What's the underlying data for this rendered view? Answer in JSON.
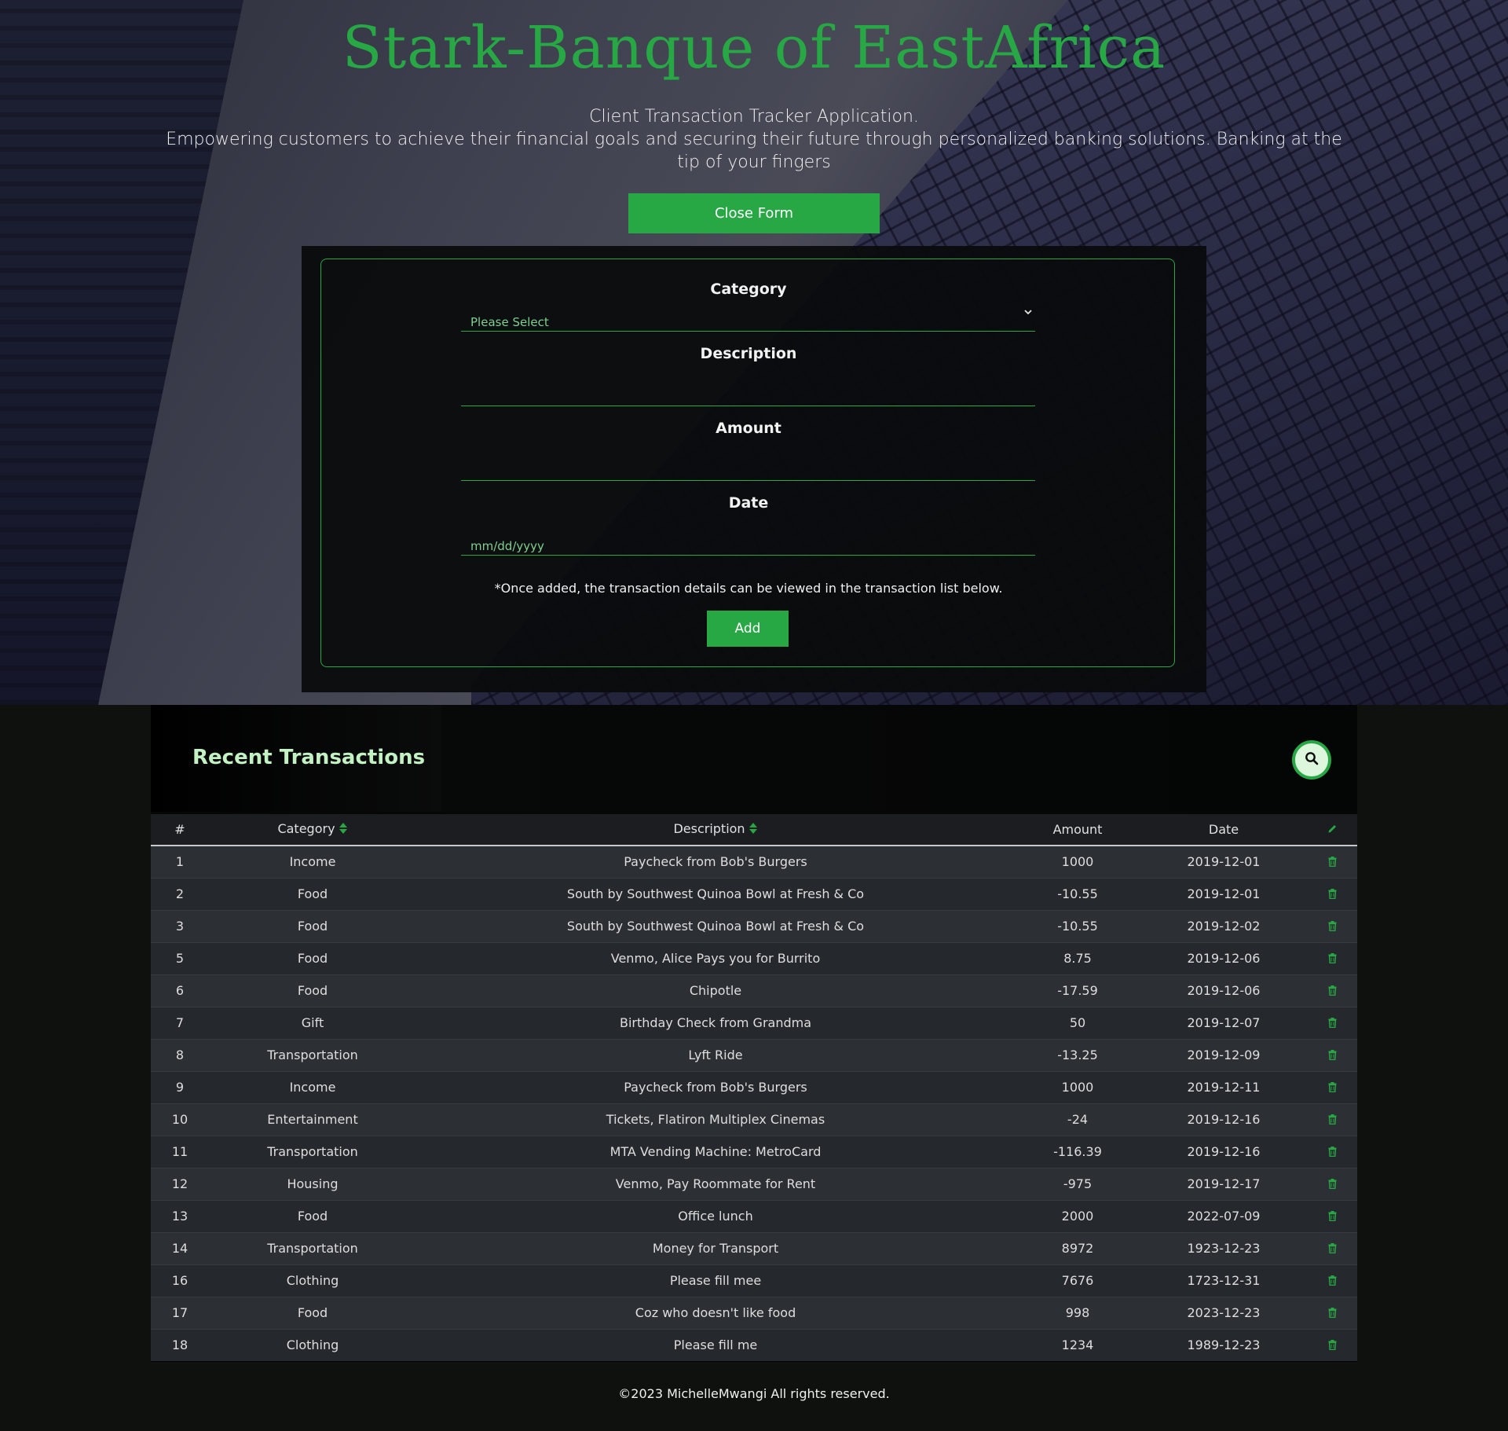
{
  "hero": {
    "title": "Stark-Banque of EastAfrica",
    "subtitle_line1": "Client Transaction Tracker Application.",
    "subtitle_line2": "Empowering customers to achieve their financial goals and securing their future through personalized banking solutions. Banking at the tip of your fingers",
    "close_form_label": "Close Form"
  },
  "form": {
    "category_label": "Category",
    "category_value": "Please Select",
    "description_label": "Description",
    "description_value": "",
    "amount_label": "Amount",
    "amount_value": "",
    "date_label": "Date",
    "date_placeholder": "mm/dd/yyyy",
    "note": "*Once added, the transaction details can be viewed in the transaction list below.",
    "add_label": "Add"
  },
  "transactions": {
    "title": "Recent Transactions",
    "columns": [
      "#",
      "Category",
      "Description",
      "Amount",
      "Date"
    ],
    "rows": [
      {
        "id": "1",
        "category": "Income",
        "description": "Paycheck from Bob's Burgers",
        "amount": "1000",
        "date": "2019-12-01"
      },
      {
        "id": "2",
        "category": "Food",
        "description": "South by Southwest Quinoa Bowl at Fresh & Co",
        "amount": "-10.55",
        "date": "2019-12-01"
      },
      {
        "id": "3",
        "category": "Food",
        "description": "South by Southwest Quinoa Bowl at Fresh & Co",
        "amount": "-10.55",
        "date": "2019-12-02"
      },
      {
        "id": "5",
        "category": "Food",
        "description": "Venmo, Alice Pays you for Burrito",
        "amount": "8.75",
        "date": "2019-12-06"
      },
      {
        "id": "6",
        "category": "Food",
        "description": "Chipotle",
        "amount": "-17.59",
        "date": "2019-12-06"
      },
      {
        "id": "7",
        "category": "Gift",
        "description": "Birthday Check from Grandma",
        "amount": "50",
        "date": "2019-12-07"
      },
      {
        "id": "8",
        "category": "Transportation",
        "description": "Lyft Ride",
        "amount": "-13.25",
        "date": "2019-12-09"
      },
      {
        "id": "9",
        "category": "Income",
        "description": "Paycheck from Bob's Burgers",
        "amount": "1000",
        "date": "2019-12-11"
      },
      {
        "id": "10",
        "category": "Entertainment",
        "description": "Tickets, Flatiron Multiplex Cinemas",
        "amount": "-24",
        "date": "2019-12-16"
      },
      {
        "id": "11",
        "category": "Transportation",
        "description": "MTA Vending Machine: MetroCard",
        "amount": "-116.39",
        "date": "2019-12-16"
      },
      {
        "id": "12",
        "category": "Housing",
        "description": "Venmo, Pay Roommate for Rent",
        "amount": "-975",
        "date": "2019-12-17"
      },
      {
        "id": "13",
        "category": "Food",
        "description": "Office lunch",
        "amount": "2000",
        "date": "2022-07-09"
      },
      {
        "id": "14",
        "category": "Transportation",
        "description": "Money for Transport",
        "amount": "8972",
        "date": "1923-12-23"
      },
      {
        "id": "16",
        "category": "Clothing",
        "description": "Please fill mee",
        "amount": "7676",
        "date": "1723-12-31"
      },
      {
        "id": "17",
        "category": "Food",
        "description": "Coz who doesn't like food",
        "amount": "998",
        "date": "2023-12-23"
      },
      {
        "id": "18",
        "category": "Clothing",
        "description": "Please fill me",
        "amount": "1234",
        "date": "1989-12-23"
      }
    ]
  },
  "footer": {
    "text": "©2023 MichelleMwangi All rights reserved."
  },
  "icons": {
    "sort": "sort-icon",
    "edit": "pencil-icon",
    "delete": "trash-icon",
    "search": "search-icon",
    "select": "chevron-down-icon"
  },
  "colors": {
    "accent": "#28a745",
    "title": "#27a845",
    "heading_light": "#c2f2c2"
  }
}
